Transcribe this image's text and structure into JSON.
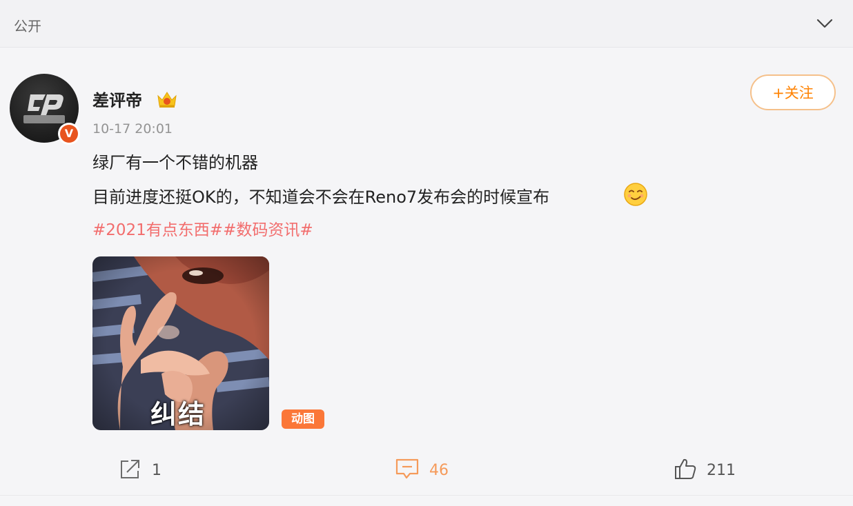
{
  "header": {
    "visibility_label": "公开",
    "collapse_icon": "chevron-down-icon"
  },
  "post": {
    "author": {
      "name": "差评帝",
      "verified_badge": "V",
      "member_icon": "crown-icon"
    },
    "timestamp": "10-17 20:01",
    "follow_label": "+关注",
    "lines": [
      "绿厂有一个不错的机器",
      "目前进度还挺OK的，不知道会不会在Reno7发布会的时候宣布"
    ],
    "emoji": "smirk-emoji-icon",
    "tags": [
      "#2021有点东西#",
      "#数码资讯#"
    ],
    "media": {
      "caption": "纠结",
      "badge": "动图"
    },
    "actions": {
      "repost": {
        "icon": "share-icon",
        "count": "1"
      },
      "comment": {
        "icon": "comment-icon",
        "count": "46"
      },
      "like": {
        "icon": "thumbs-up-icon",
        "count": "211"
      }
    }
  },
  "colors": {
    "accent_orange": "#ff8200",
    "tag_red": "#f26d6d",
    "badge_orange": "#fb7738",
    "comment_orange": "#f59a5a"
  }
}
